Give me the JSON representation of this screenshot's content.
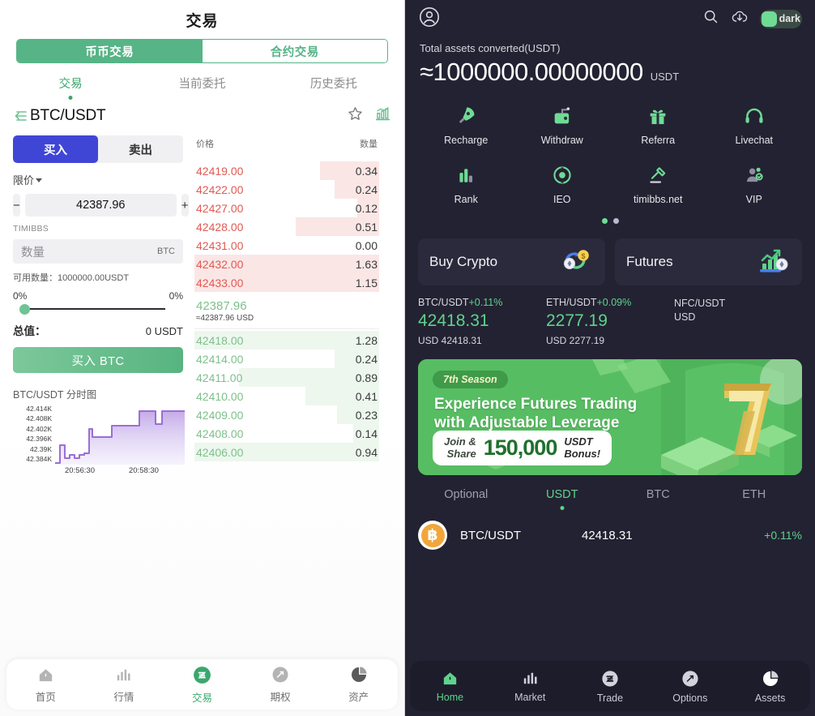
{
  "left": {
    "title": "交易",
    "segments": [
      {
        "label": "币币交易",
        "active": true
      },
      {
        "label": "合约交易",
        "active": false
      }
    ],
    "subtabs": [
      {
        "label": "交易",
        "active": true
      },
      {
        "label": "当前委托",
        "active": false
      },
      {
        "label": "历史委托",
        "active": false
      }
    ],
    "pair": {
      "name": "BTC/USDT",
      "back_icon": "back-arrow-icon",
      "star_icon": "star-icon",
      "chart_icon": "chart-bars-icon"
    },
    "form": {
      "buy_label": "买入",
      "sell_label": "卖出",
      "order_type": "限价",
      "minus_label": "−",
      "plus_label": "+",
      "price_value": "42387.96",
      "brand_label": "TIMIBBS",
      "qty_placeholder": "数量",
      "qty_unit": "BTC",
      "available_label": "可用数量：1000000.00USDT",
      "pct_left": "0%",
      "pct_right": "0%",
      "total_label": "总值：",
      "total_value": "0 USDT",
      "submit_label": "买入 BTC"
    },
    "chart": {
      "title": "BTC/USDT 分时图",
      "y_labels": [
        "42.414K",
        "42.408K",
        "42.402K",
        "42.396K",
        "42.39K",
        "42.384K"
      ],
      "x_labels": [
        "20:56:30",
        "20:58:30"
      ]
    },
    "orderbook": {
      "col_price": "价格",
      "col_qty": "数量",
      "asks": [
        {
          "price": "42419.00",
          "qty": "0.34",
          "depth": 32,
          "pxbg": 0
        },
        {
          "price": "42422.00",
          "qty": "0.24",
          "depth": 24,
          "pxbg": 0
        },
        {
          "price": "42427.00",
          "qty": "0.12",
          "depth": 12,
          "pxbg": 0
        },
        {
          "price": "42428.00",
          "qty": "0.51",
          "depth": 45,
          "pxbg": 0
        },
        {
          "price": "42431.00",
          "qty": "0.00",
          "depth": 0,
          "pxbg": 0
        },
        {
          "price": "42432.00",
          "qty": "1.63",
          "depth": 100,
          "pxbg": 100
        },
        {
          "price": "42433.00",
          "qty": "1.15",
          "depth": 100,
          "pxbg": 36
        }
      ],
      "last_price": "42387.96",
      "last_sub": "≈42387.96 USD",
      "bids": [
        {
          "price": "42418.00",
          "qty": "1.28",
          "depth": 100,
          "pxbg": 100
        },
        {
          "price": "42414.00",
          "qty": "0.24",
          "depth": 24,
          "pxbg": 0
        },
        {
          "price": "42411.00",
          "qty": "0.89",
          "depth": 76,
          "pxbg": 0
        },
        {
          "price": "42410.00",
          "qty": "0.41",
          "depth": 40,
          "pxbg": 0
        },
        {
          "price": "42409.00",
          "qty": "0.23",
          "depth": 23,
          "pxbg": 0
        },
        {
          "price": "42408.00",
          "qty": "0.14",
          "depth": 14,
          "pxbg": 0
        },
        {
          "price": "42406.00",
          "qty": "0.94",
          "depth": 80,
          "pxbg": 30
        }
      ]
    },
    "nav": [
      {
        "label": "首页",
        "icon": "home-icon",
        "active": false
      },
      {
        "label": "行情",
        "icon": "market-bars-icon",
        "active": false
      },
      {
        "label": "交易",
        "icon": "trade-icon",
        "active": true
      },
      {
        "label": "期权",
        "icon": "options-icon",
        "active": false
      },
      {
        "label": "资产",
        "icon": "assets-pie-icon",
        "active": false
      }
    ]
  },
  "right": {
    "header": {
      "avatar_icon": "user-avatar-icon",
      "search_icon": "search-icon",
      "download_icon": "download-cloud-icon",
      "theme_label": "dark"
    },
    "assets": {
      "label": "Total assets converted(USDT)",
      "value": "≈1000000.00000000",
      "currency": "USDT"
    },
    "quick_actions": [
      {
        "label": "Recharge",
        "icon": "rocket-icon"
      },
      {
        "label": "Withdraw",
        "icon": "withdraw-wallet-icon"
      },
      {
        "label": "Referra",
        "icon": "gift-icon"
      },
      {
        "label": "Livechat",
        "icon": "headset-icon"
      },
      {
        "label": "Rank",
        "icon": "rank-bars-icon"
      },
      {
        "label": "IEO",
        "icon": "atom-icon"
      },
      {
        "label": "timibbs.net",
        "icon": "gavel-icon"
      },
      {
        "label": "VIP",
        "icon": "vip-badge-icon"
      }
    ],
    "pager": {
      "total": 2,
      "active": 0
    },
    "cards": [
      {
        "title": "Buy Crypto",
        "icon": "exchange-coin-icon"
      },
      {
        "title": "Futures",
        "icon": "growth-chart-icon"
      }
    ],
    "tickers": [
      {
        "pair": "BTC/USDT",
        "change": "+0.11%",
        "price": "42418.31",
        "sub": "USD 42418.31"
      },
      {
        "pair": "ETH/USDT",
        "change": "+0.09%",
        "price": "2277.19",
        "sub": "USD 2277.19"
      },
      {
        "pair": "NFC/USDT",
        "change": "",
        "price": "",
        "sub": "USD"
      }
    ],
    "banner": {
      "season": "7th Season",
      "headline_1": "Experience Futures Trading",
      "headline_2": "with Adjustable Leverage",
      "join_1": "Join &",
      "join_2": "Share",
      "amount": "150,000",
      "usdt": "USDT",
      "bonus": "Bonus!",
      "numeral": "7"
    },
    "market_tabs": [
      {
        "label": "Optional",
        "active": false
      },
      {
        "label": "USDT",
        "active": true
      },
      {
        "label": "BTC",
        "active": false
      },
      {
        "label": "ETH",
        "active": false
      }
    ],
    "market_rows": [
      {
        "icon": "bitcoin-icon",
        "symbol": "BTC/USDT",
        "price": "42418.31",
        "change": "+0.11%"
      }
    ],
    "nav": [
      {
        "label": "Home",
        "icon": "home-icon",
        "active": true
      },
      {
        "label": "Market",
        "icon": "market-bars-icon",
        "active": false
      },
      {
        "label": "Trade",
        "icon": "trade-icon",
        "active": false
      },
      {
        "label": "Options",
        "icon": "options-icon",
        "active": false
      },
      {
        "label": "Assets",
        "icon": "assets-pie-icon",
        "active": false
      }
    ]
  },
  "colors": {
    "green": "#57b487",
    "green_light": "#5fd38c",
    "blue": "#3f46d6",
    "red": "#e05a52",
    "dark_bg": "#232232",
    "card_bg": "#2b2a3c"
  }
}
